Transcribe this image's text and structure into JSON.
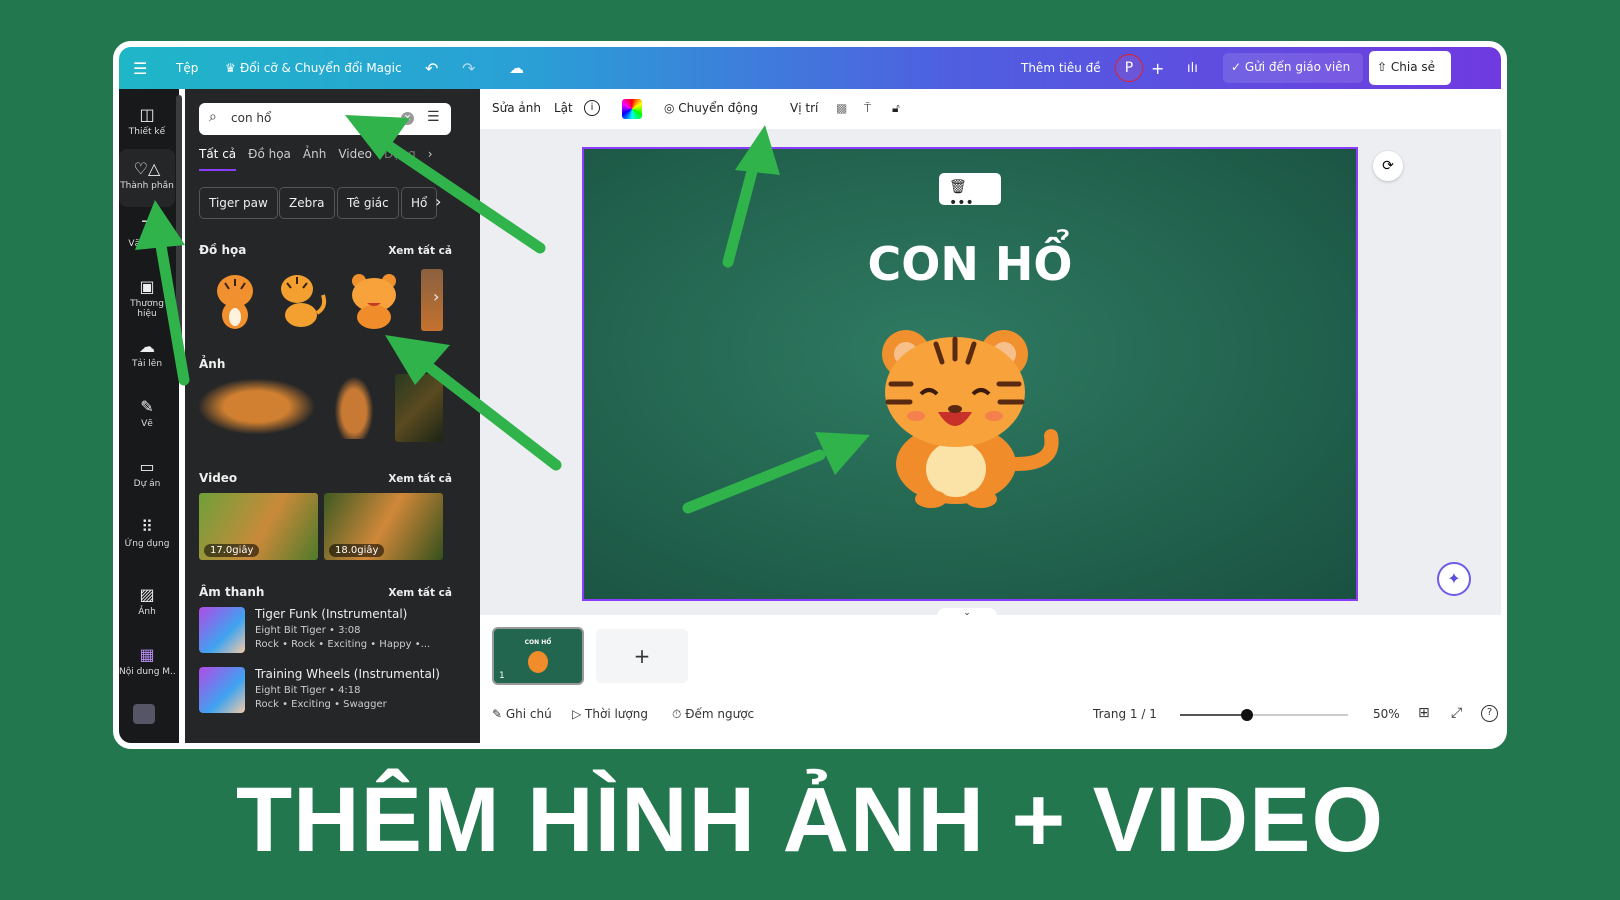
{
  "topbar": {
    "menu_icon": "hamburger-icon",
    "file": "Tệp",
    "magic_resize": "Đổi cỡ & Chuyển đổi Magic",
    "add_title": "Thêm tiêu đề",
    "avatar": "P",
    "send_teacher": "Gửi đến giáo viên",
    "share": "Chia sẻ"
  },
  "rail": [
    {
      "label": "Thiết kế",
      "icon": "layout-icon"
    },
    {
      "label": "Thành phần",
      "icon": "shapes-icon"
    },
    {
      "label": "Văn bản",
      "icon": "text-icon"
    },
    {
      "label": "Thương hiệu",
      "icon": "brand-icon"
    },
    {
      "label": "Tải lên",
      "icon": "upload-icon"
    },
    {
      "label": "Vẽ",
      "icon": "draw-icon"
    },
    {
      "label": "Dự án",
      "icon": "folder-icon"
    },
    {
      "label": "Ứng dụng",
      "icon": "apps-icon"
    },
    {
      "label": "Ảnh",
      "icon": "image-icon"
    },
    {
      "label": "Nội dung M...",
      "icon": "magic-media-icon"
    }
  ],
  "panel": {
    "search_value": "con hổ",
    "tabs": [
      "Tất cả",
      "Đồ họa",
      "Ảnh",
      "Video",
      "Dạng"
    ],
    "chips": [
      "Tiger paw",
      "Zebra",
      "Tê giác",
      "Hổ"
    ],
    "graphics_title": "Đồ họa",
    "photos_title": "Ảnh",
    "videos_title": "Video",
    "audio_title": "Âm thanh",
    "see_all": "Xem tất cả",
    "videos": [
      {
        "duration": "17.0giây"
      },
      {
        "duration": "18.0giây"
      }
    ],
    "audio": [
      {
        "title": "Tiger Funk (Instrumental)",
        "meta": "Eight Bit Tiger • 3:08",
        "tags": "Rock • Rock • Exciting • Happy •..."
      },
      {
        "title": "Training Wheels (Instrumental)",
        "meta": "Eight Bit Tiger • 4:18",
        "tags": "Rock • Exciting • Swagger"
      }
    ]
  },
  "toolbar": {
    "edit_image": "Sửa ảnh",
    "flip": "Lật",
    "animate": "Chuyển động",
    "position": "Vị trí"
  },
  "slide": {
    "title": "CON HỔ",
    "thumb_title": "CON HỔ",
    "page_number": "1"
  },
  "footer": {
    "notes": "Ghi chú",
    "duration": "Thời lượng",
    "timer": "Đếm ngược",
    "page": "Trang 1 / 1",
    "zoom": "50%",
    "zoom_value": 50
  },
  "caption": "THÊM HÌNH ẢNH + VIDEO",
  "colors": {
    "background": "#23774f",
    "accent": "#8b3dff",
    "arrow": "#2fb34a"
  }
}
